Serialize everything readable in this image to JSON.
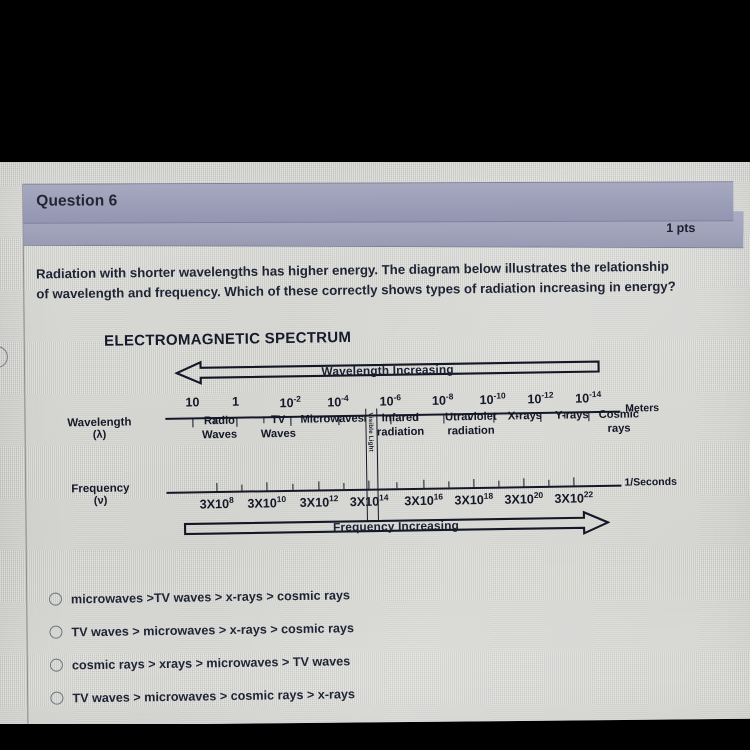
{
  "question": {
    "title": "Question 6",
    "points": "1 pts",
    "prompt": "Radiation with shorter wavelengths has higher energy. The diagram below illustrates the relationship of wavelength and frequency. Which of these correctly shows types of radiation increasing in energy?"
  },
  "diagram": {
    "title": "ELECTROMAGNETIC SPECTRUM",
    "wavelength_arrow_label": "Wavelength Increasing",
    "frequency_arrow_label": "Frequency Increasing",
    "wavelength_row_label": "Wavelength",
    "wavelength_symbol": "(λ)",
    "frequency_row_label": "Frequency",
    "frequency_symbol": "(ν)",
    "wavelength_unit": "Meters",
    "frequency_unit": "1/Seconds",
    "visible_light_label": "Visible Light"
  },
  "chart_data": {
    "type": "line",
    "title": "ELECTROMAGNETIC SPECTRUM",
    "xlabel": "Wavelength (λ) / Frequency (ν)",
    "ylabel": "",
    "grid": false,
    "legend_position": "none",
    "annotations": [
      "Wavelength Increasing (arrow points left)",
      "Frequency Increasing (arrow points right)"
    ],
    "axes": [
      {
        "name": "Wavelength",
        "symbol": "(λ)",
        "unit": "Meters",
        "direction": "decreasing left to right",
        "tick_labels": [
          "10",
          "1",
          "10⁻²",
          "10⁻⁴",
          "10⁻⁶",
          "10⁻⁸",
          "10⁻¹⁰",
          "10⁻¹²",
          "10⁻¹⁴"
        ],
        "tick_bases": [
          10,
          1,
          10,
          10,
          10,
          10,
          10,
          10,
          10
        ],
        "tick_exponents": [
          null,
          null,
          "-2",
          "-4",
          "-6",
          "-8",
          "-10",
          "-12",
          "-14"
        ],
        "tick_positions_pct": [
          6,
          15.5,
          27.5,
          38,
          49.5,
          61,
          72,
          82.5,
          93
        ]
      },
      {
        "name": "Frequency",
        "symbol": "(ν)",
        "unit": "1/Seconds",
        "direction": "increasing left to right",
        "tick_labels": [
          "3X10⁸",
          "3X10¹⁰",
          "3X10¹²",
          "3X10¹⁴",
          "3X10¹⁶",
          "3X10¹⁸",
          "3X10²⁰",
          "3X10²²"
        ],
        "tick_mantissa": "3X10",
        "tick_exponents": [
          "8",
          "10",
          "12",
          "14",
          "16",
          "18",
          "20",
          "22"
        ],
        "tick_positions_pct": [
          11,
          22,
          33.5,
          44.5,
          56.5,
          67.5,
          78.5,
          89.5
        ]
      }
    ],
    "categories": [
      "Radio Waves",
      "TV Waves",
      "Microwaves",
      "Infared radiation",
      "Visible Light",
      "Utraviolet radiation",
      "X-rays",
      "Y-rays",
      "Cosmic rays"
    ],
    "bands": [
      {
        "line1": "Radio",
        "line2": "Waves",
        "center_pct": 11.5
      },
      {
        "line1": "TV",
        "line2": "Waves",
        "center_pct": 24.0
      },
      {
        "line1": "Microwaves",
        "line2": "",
        "center_pct": 35.5
      },
      {
        "line1": "Infared",
        "line2": "radiation",
        "center_pct": 50.0
      },
      {
        "line1": "Utraviolet",
        "line2": "radiation",
        "center_pct": 65.0
      },
      {
        "line1": "X-rays",
        "line2": "",
        "center_pct": 76.5
      },
      {
        "line1": "Y-rays",
        "line2": "",
        "center_pct": 86.5
      },
      {
        "line1": "Cosmic",
        "line2": "rays",
        "center_pct": 96.5
      }
    ]
  },
  "choices": [
    {
      "label": "microwaves >TV waves > x-rays > cosmic rays",
      "selected": false
    },
    {
      "label": "TV waves > microwaves > x-rays > cosmic rays",
      "selected": false
    },
    {
      "label": "cosmic rays > xrays > microwaves > TV waves",
      "selected": false
    },
    {
      "label": "TV waves > microwaves > cosmic rays > x-rays",
      "selected": false
    }
  ],
  "colors": {
    "header_bar": "#9b9eb7",
    "page_bg": "#d4d4cf",
    "text": "#1f2434",
    "letterbox": "#000000"
  }
}
